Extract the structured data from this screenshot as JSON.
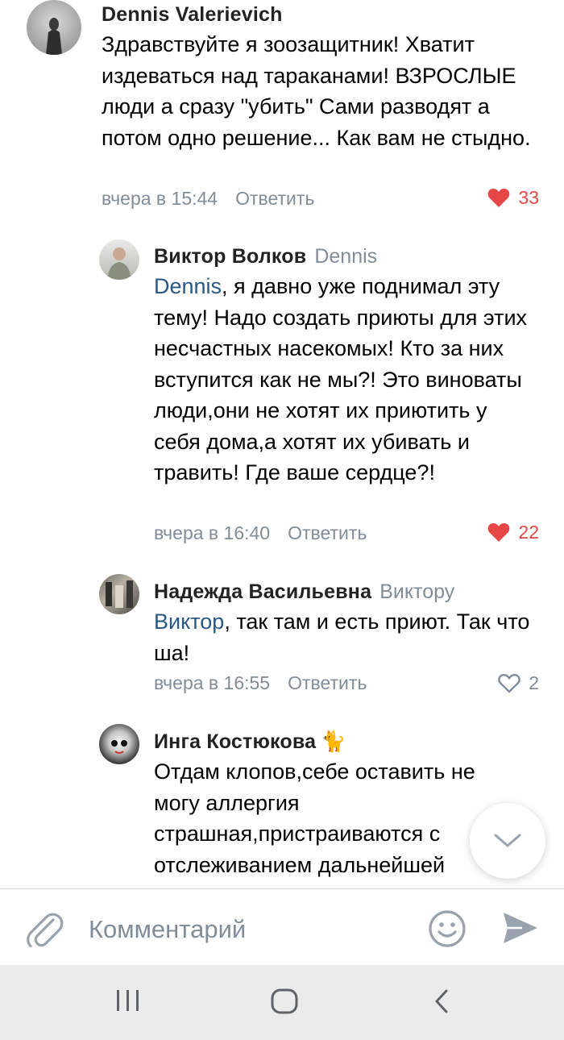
{
  "comments": [
    {
      "author": "Dennis Valerievich",
      "reply_to": "",
      "mention": "",
      "text": "Здравствуйте я зоозащитник! Хватит издеваться над тараканами! ВЗРОСЛЫЕ люди а сразу \"убить\" Сами разводят а потом одно решение... Как вам не стыдно.",
      "time": "вчера в 15:44",
      "reply_label": "Ответить",
      "likes": "33",
      "liked": true
    },
    {
      "author": "Виктор Волков",
      "reply_to": "Dennis",
      "mention": "Dennis",
      "text": ", я давно уже поднимал эту тему! Надо создать приюты для этих несчастных насекомых! Кто за них вступится как не мы?! Это виноваты люди,они  не хотят их приютить у себя дома,а хотят их убивать и травить! Где ваше сердце?!",
      "time": "вчера в 16:40",
      "reply_label": "Ответить",
      "likes": "22",
      "liked": true
    },
    {
      "author": "Надежда Васильевна",
      "reply_to": "Виктору",
      "mention": "Виктор",
      "text": ", так там и есть приют. Так что ша!",
      "time": "вчера в 16:55",
      "reply_label": "Ответить",
      "likes": "2",
      "liked": false
    },
    {
      "author": "Инга Костюкова",
      "author_emoji": "🐈",
      "reply_to": "",
      "mention": "",
      "text": "Отдам клопов,себе оставить не могу аллергия страшная,пристраиваются с отслеживанием дальнейшей",
      "time": "",
      "reply_label": "",
      "likes": "",
      "liked": false
    }
  ],
  "composer": {
    "placeholder": "Комментарий",
    "attach_icon": "paperclip-icon",
    "emoji_icon": "smiley-icon",
    "send_icon": "send-icon"
  },
  "navbar": {
    "recent_icon": "recent-apps-icon",
    "home_icon": "home-icon",
    "back_icon": "back-icon"
  },
  "colors": {
    "link": "#2a5885",
    "secondary": "#818c99",
    "like_active": "#e64646",
    "navbar_bg": "#ebebeb"
  }
}
